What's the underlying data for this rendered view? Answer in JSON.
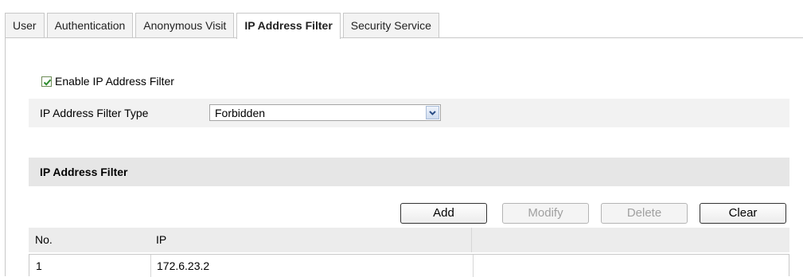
{
  "tabs": [
    {
      "label": "User",
      "active": false
    },
    {
      "label": "Authentication",
      "active": false
    },
    {
      "label": "Anonymous Visit",
      "active": false
    },
    {
      "label": "IP Address Filter",
      "active": true
    },
    {
      "label": "Security Service",
      "active": false
    }
  ],
  "enable": {
    "label": "Enable IP Address Filter",
    "checked": true
  },
  "filter_type": {
    "label": "IP Address Filter Type",
    "value": "Forbidden"
  },
  "section": {
    "title": "IP Address Filter"
  },
  "buttons": {
    "add": "Add",
    "modify": "Modify",
    "delete": "Delete",
    "clear": "Clear"
  },
  "table": {
    "headers": [
      "No.",
      "IP"
    ],
    "rows": [
      {
        "no": "1",
        "ip": "172.6.23.2"
      }
    ]
  },
  "icons": {
    "checkbox": "checkmark-icon",
    "select_arrow": "chevron-down-icon"
  },
  "colors": {
    "check": "#2e8b2e",
    "tab_active_bg": "#ffffff",
    "section_bg": "#e6e6e6"
  }
}
